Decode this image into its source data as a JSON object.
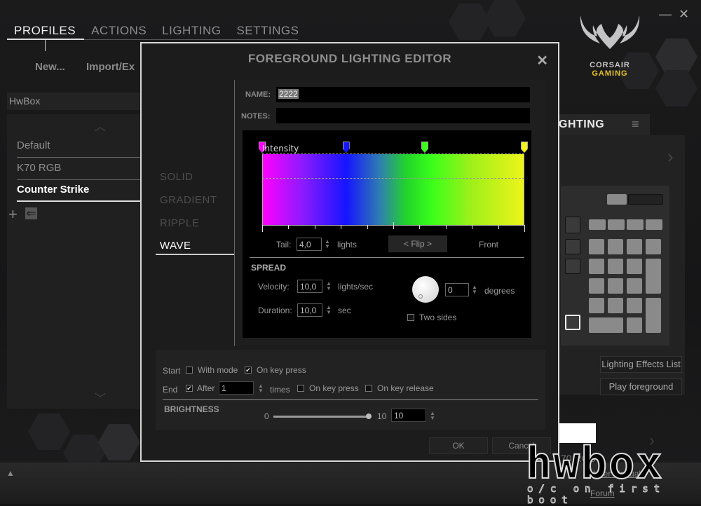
{
  "nav": {
    "tabs": [
      "PROFILES",
      "ACTIONS",
      "LIGHTING",
      "SETTINGS"
    ],
    "active": "PROFILES"
  },
  "subactions": {
    "new": "New...",
    "import": "Import/Ex"
  },
  "window": {
    "minimize": "—",
    "close": "✕"
  },
  "logo": {
    "line1": "CORSAIR",
    "line2": "GAMING",
    "brand_color": "#e5c125"
  },
  "profiles": {
    "header": "HwBox",
    "items": [
      "Default",
      "K70 RGB",
      "Counter Strike"
    ],
    "selected": "Counter Strike",
    "add_icon": "+",
    "import_icon": "⇐"
  },
  "right_panel": {
    "tab_label": "GHTING",
    "menu_icon": "≡",
    "next_icon": "›",
    "buttons": [
      "Lighting Effects List",
      "Play foreground"
    ],
    "device_label": "70 RGB",
    "links": [
      "User Manual",
      "Forum"
    ]
  },
  "dialog": {
    "title": "FOREGROUND LIGHTING EDITOR",
    "close": "✕",
    "modes": [
      "SOLID",
      "GRADIENT",
      "RIPPLE",
      "WAVE"
    ],
    "selected_mode": "WAVE",
    "name_label": "NAME:",
    "name_value": "2222",
    "notes_label": "NOTES:",
    "notes_value": "",
    "intensity_label": "Intensity",
    "gradient_stops": [
      {
        "position": 0.0,
        "color": "#ff00ff"
      },
      {
        "position": 0.32,
        "color": "#1515ff"
      },
      {
        "position": 0.62,
        "color": "#3bff1a"
      },
      {
        "position": 1.0,
        "color": "#f4f41a"
      }
    ],
    "tail_label": "Tail:",
    "tail_value": "4,0",
    "tail_unit": "lights",
    "flip_label": "< Flip >",
    "front_label": "Front",
    "spread_label": "SPREAD",
    "velocity_label": "Velocity:",
    "velocity_value": "10,0",
    "velocity_unit": "lights/sec",
    "duration_label": "Duration:",
    "duration_value": "10,0",
    "duration_unit": "sec",
    "angle_value": "0",
    "angle_unit": "degrees",
    "two_sides_label": "Two sides",
    "two_sides_checked": false,
    "start_label": "Start",
    "with_mode_label": "With mode",
    "with_mode_checked": false,
    "on_key_press_label": "On key press",
    "start_on_key_press_checked": true,
    "end_label": "End",
    "after_label": "After",
    "after_checked": true,
    "after_value": "1",
    "times_label": "times",
    "end_on_key_press_label": "On key press",
    "end_on_key_press_checked": false,
    "on_key_release_label": "On key release",
    "on_key_release_checked": false,
    "brightness_label": "BRIGHTNESS",
    "brightness_min": "0",
    "brightness_max": "10",
    "brightness_value": "10",
    "ok_label": "OK",
    "cancel_label": "Cancel"
  },
  "watermark": {
    "main": "hwbox",
    "sub": "o/c on first boot"
  }
}
